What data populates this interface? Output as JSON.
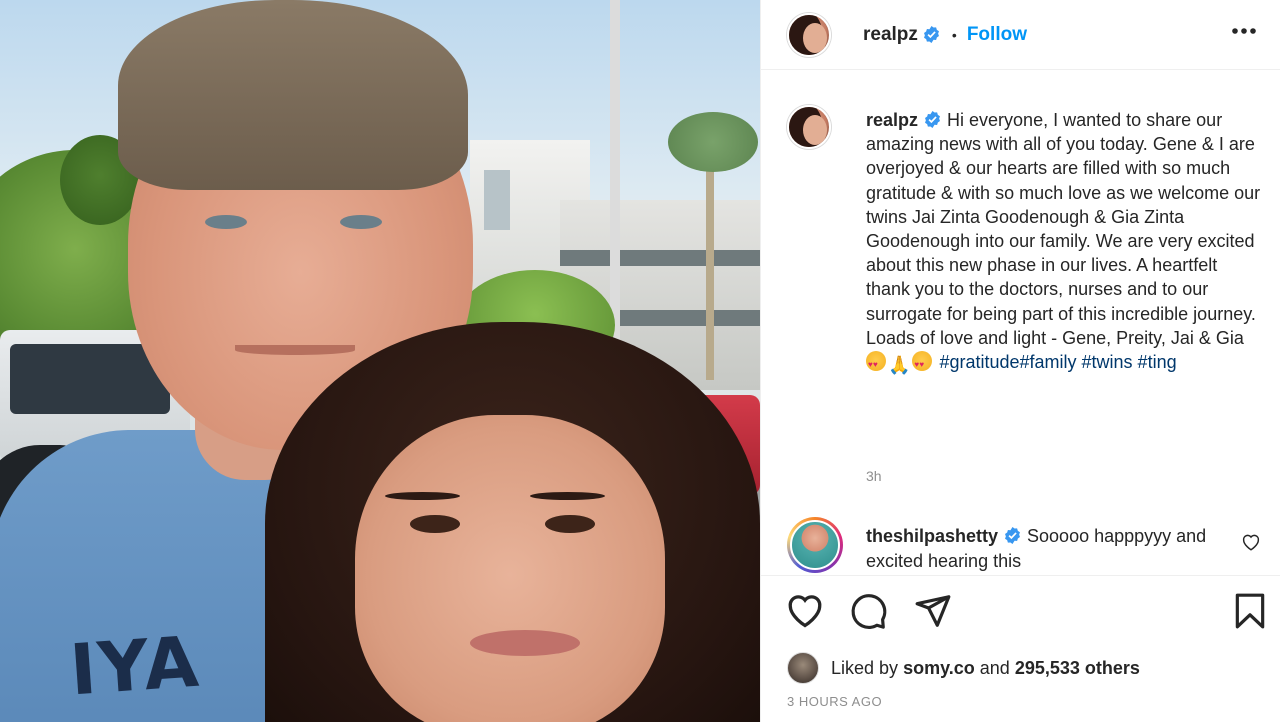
{
  "post": {
    "username": "realpz",
    "follow_label": "Follow",
    "separator": "•",
    "caption": "Hi everyone, I wanted to share our amazing news with all of you today. Gene & I are overjoyed & our hearts are filled with so much gratitude & with so much love as we welcome our twins Jai Zinta Goodenough & Gia Zinta Goodenough into our family. We are very excited about this new phase in our lives. A heartfelt thank you to the doctors, nurses and to our surrogate for being part of this incredible journey. Loads of love and light - Gene, Preity, Jai & Gia",
    "hashtags_line1": "#gratitude#family",
    "hashtags_line2": "#twins #ting",
    "caption_age": "3h",
    "photo_shirt_text": "IYA"
  },
  "comment": {
    "username": "theshilpashetty",
    "text": "Sooooo happpyyy and excited hearing this"
  },
  "engagement": {
    "liked_by_prefix": "Liked by",
    "liked_by_user": "somy.co",
    "and_label": "and",
    "others_count": "295,533 others",
    "posted_time": "3 HOURS AGO"
  },
  "icons": {
    "verified": "verified-badge-icon",
    "more": "more-options-icon",
    "like": "heart-icon",
    "comment": "comment-icon",
    "share": "share-icon",
    "save": "bookmark-icon"
  },
  "colors": {
    "accent": "#0095f6",
    "hashtag": "#00376b",
    "muted": "#8e8e8e",
    "text": "#262626"
  }
}
